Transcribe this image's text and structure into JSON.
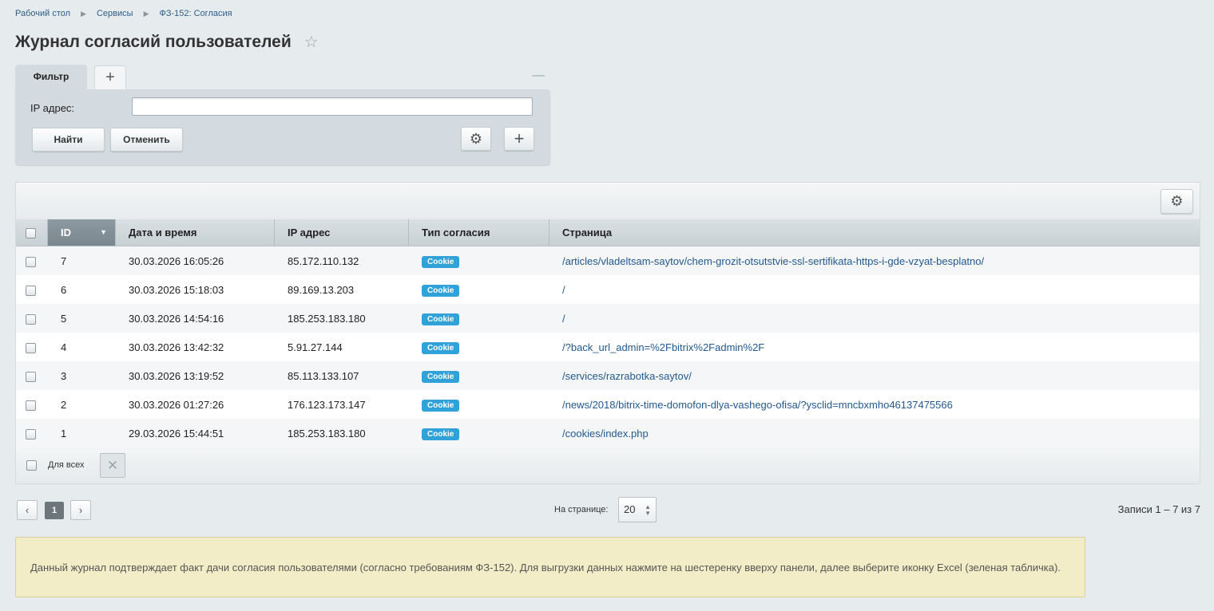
{
  "breadcrumb": [
    "Рабочий стол",
    "Сервисы",
    "ФЗ-152: Согласия"
  ],
  "page": {
    "title": "Журнал согласий пользователей"
  },
  "filter": {
    "tab_label": "Фильтр",
    "ip_label": "IP адрес:",
    "ip_value": "",
    "find_label": "Найти",
    "cancel_label": "Отменить"
  },
  "table": {
    "columns": [
      "ID",
      "Дата и время",
      "IP адрес",
      "Тип согласия",
      "Страница"
    ],
    "sorted_column": "ID",
    "rows": [
      {
        "id": "7",
        "datetime": "30.03.2026 16:05:26",
        "ip": "85.172.110.132",
        "type": "Cookie",
        "page": "/articles/vladeltsam-saytov/chem-grozit-otsutstvie-ssl-sertifikata-https-i-gde-vzyat-besplatno/"
      },
      {
        "id": "6",
        "datetime": "30.03.2026 15:18:03",
        "ip": "89.169.13.203",
        "type": "Cookie",
        "page": "/"
      },
      {
        "id": "5",
        "datetime": "30.03.2026 14:54:16",
        "ip": "185.253.183.180",
        "type": "Cookie",
        "page": "/"
      },
      {
        "id": "4",
        "datetime": "30.03.2026 13:42:32",
        "ip": "5.91.27.144",
        "type": "Cookie",
        "page": "/?back_url_admin=%2Fbitrix%2Fadmin%2F"
      },
      {
        "id": "3",
        "datetime": "30.03.2026 13:19:52",
        "ip": "85.113.133.107",
        "type": "Cookie",
        "page": "/services/razrabotka-saytov/"
      },
      {
        "id": "2",
        "datetime": "30.03.2026 01:27:26",
        "ip": "176.123.173.147",
        "type": "Cookie",
        "page": "/news/2018/bitrix-time-domofon-dlya-vashego-ofisa/?ysclid=mncbxmho46137475566"
      },
      {
        "id": "1",
        "datetime": "29.03.2026 15:44:51",
        "ip": "185.253.183.180",
        "type": "Cookie",
        "page": "/cookies/index.php"
      }
    ],
    "footer_all_label": "Для всех"
  },
  "pagination": {
    "current_page": "1",
    "per_page_label": "На странице:",
    "per_page_value": "20",
    "records_info": "Записи 1 – 7 из 7"
  },
  "notice": "Данный журнал подтверждает факт дачи согласия пользователями (согласно требованиям ФЗ-152). Для выгрузки данных нажмите на шестеренку вверху панели, далее выберите иконку Excel (зеленая табличка).",
  "colors": {
    "badge": "#2fa3d9",
    "link": "#235990",
    "notice_bg": "#f3edc7",
    "page_bg": "#e6ebed"
  },
  "icons": [
    "star-icon",
    "plus-icon",
    "minus-icon",
    "gear-icon",
    "sort-desc-icon",
    "close-icon",
    "chevron-left-icon",
    "chevron-right-icon"
  ]
}
